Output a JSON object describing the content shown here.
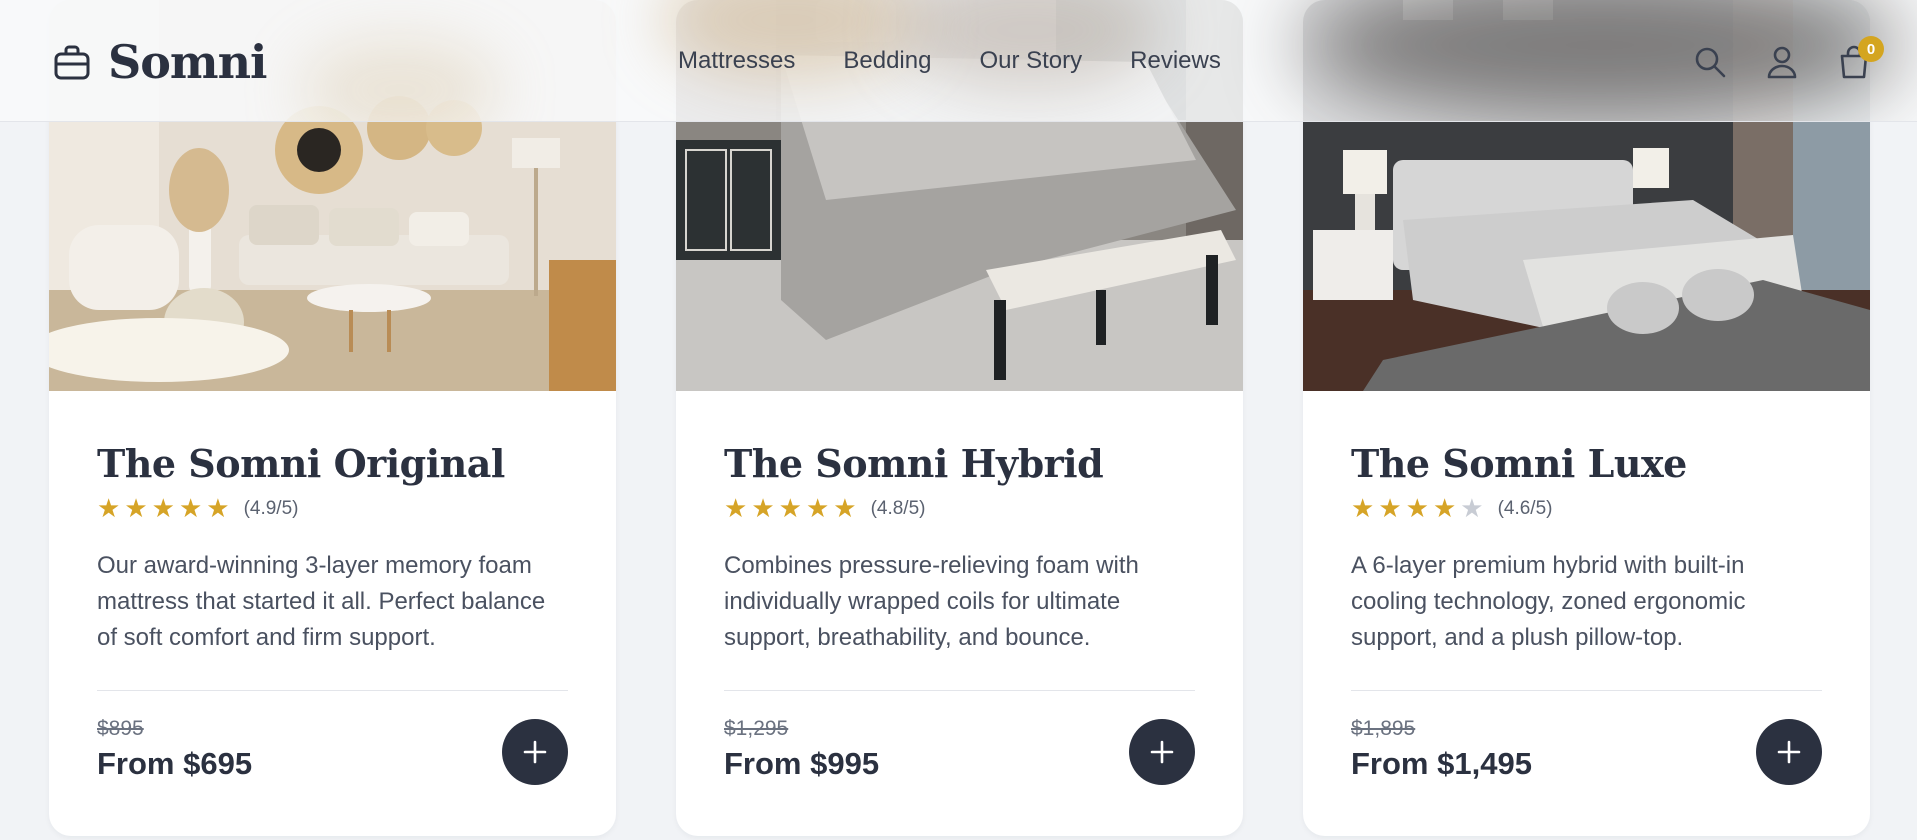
{
  "header": {
    "brand": "Somni",
    "brand_icon": "bag-icon",
    "nav": [
      "Mattresses",
      "Bedding",
      "Our Story",
      "Reviews"
    ],
    "icons": [
      "search-icon",
      "user-icon",
      "cart-icon"
    ],
    "cart_count": "0"
  },
  "colors": {
    "accent": "#d4a520",
    "star": "#d6a427",
    "dark": "#2b3140",
    "background": "#f1f3f6"
  },
  "products": [
    {
      "image": "living-room-scene",
      "title": "The Somni Original",
      "stars": 5,
      "rating": "(4.9/5)",
      "description": "Our award-winning 3-layer memory foam mattress that started it all. Perfect balance of soft comfort and firm support.",
      "old_price": "$895",
      "price": "From $695"
    },
    {
      "image": "bedroom-with-bench",
      "title": "The Somni Hybrid",
      "stars": 5,
      "rating": "(4.8/5)",
      "description": "Combines pressure-relieving foam with individually wrapped coils for ultimate support, breathability, and bounce.",
      "old_price": "$1,295",
      "price": "From $995"
    },
    {
      "image": "luxury-bedroom",
      "title": "The Somni Luxe",
      "stars": 4,
      "rating": "(4.6/5)",
      "description": "A 6-layer premium hybrid with built-in cooling technology, zoned ergonomic support, and a plush pillow-top.",
      "old_price": "$1,895",
      "price": "From $1,495"
    }
  ]
}
